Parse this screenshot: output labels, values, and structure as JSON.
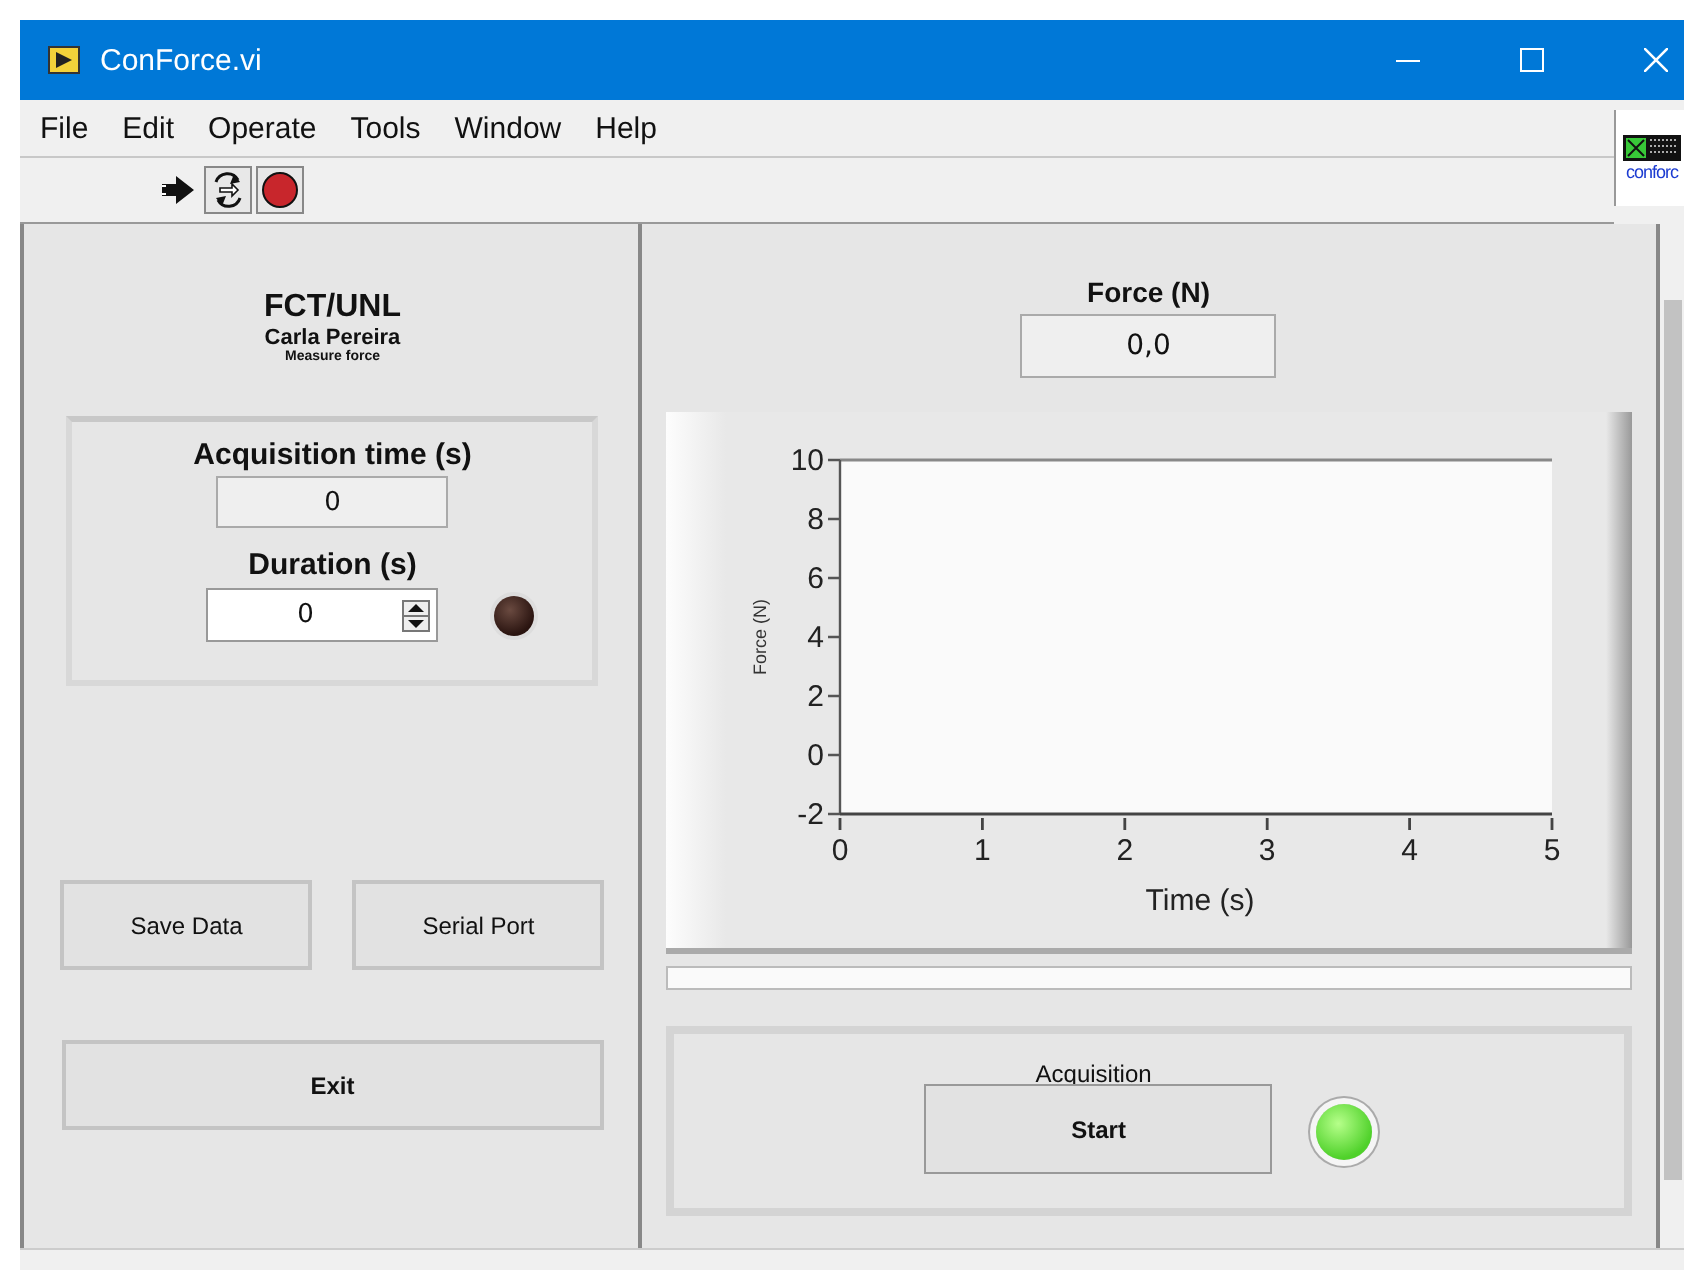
{
  "window": {
    "title": "ConForce.vi"
  },
  "menu": [
    "File",
    "Edit",
    "Operate",
    "Tools",
    "Window",
    "Help"
  ],
  "vi_icon": {
    "label": "conforc"
  },
  "header": {
    "title": "FCT/UNL",
    "author": "Carla Pereira",
    "subtitle": "Measure force"
  },
  "acquisition_time": {
    "label": "Acquisition time (s)",
    "value": "0"
  },
  "duration": {
    "label": "Duration (s)",
    "value": "0",
    "led_on": false
  },
  "buttons": [
    "Save Data",
    "Serial Port",
    "Exit"
  ],
  "force": {
    "label": "Force (N)",
    "value": "0,0"
  },
  "graph": {
    "chart_data": {
      "type": "line",
      "xlabel": "Time (s)",
      "ylabel": "Force (N)",
      "xlim": [
        0,
        5
      ],
      "ylim": [
        -2,
        10
      ],
      "xticks": [
        0,
        1,
        2,
        3,
        4,
        5
      ],
      "yticks": [
        -2,
        0,
        2,
        4,
        6,
        8,
        10
      ]
    }
  },
  "acquisition": {
    "label": "Acquisition",
    "button": "Start",
    "led_on": true
  }
}
